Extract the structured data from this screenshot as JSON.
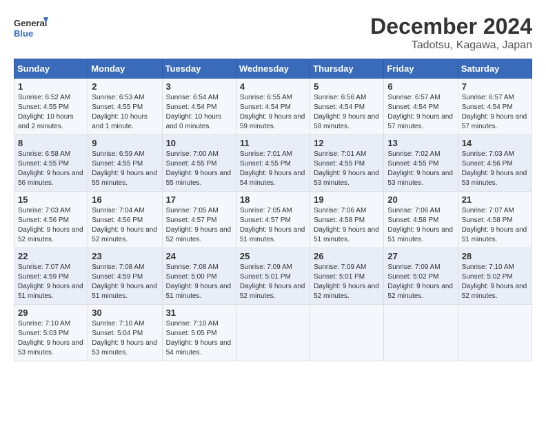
{
  "logo": {
    "line1": "General",
    "line2": "Blue"
  },
  "title": "December 2024",
  "subtitle": "Tadotsu, Kagawa, Japan",
  "weekdays": [
    "Sunday",
    "Monday",
    "Tuesday",
    "Wednesday",
    "Thursday",
    "Friday",
    "Saturday"
  ],
  "weeks": [
    [
      {
        "day": "1",
        "sunrise": "6:52 AM",
        "sunset": "4:55 PM",
        "daylight": "10 hours and 2 minutes."
      },
      {
        "day": "2",
        "sunrise": "6:53 AM",
        "sunset": "4:55 PM",
        "daylight": "10 hours and 1 minute."
      },
      {
        "day": "3",
        "sunrise": "6:54 AM",
        "sunset": "4:54 PM",
        "daylight": "10 hours and 0 minutes."
      },
      {
        "day": "4",
        "sunrise": "6:55 AM",
        "sunset": "4:54 PM",
        "daylight": "9 hours and 59 minutes."
      },
      {
        "day": "5",
        "sunrise": "6:56 AM",
        "sunset": "4:54 PM",
        "daylight": "9 hours and 58 minutes."
      },
      {
        "day": "6",
        "sunrise": "6:57 AM",
        "sunset": "4:54 PM",
        "daylight": "9 hours and 57 minutes."
      },
      {
        "day": "7",
        "sunrise": "6:57 AM",
        "sunset": "4:54 PM",
        "daylight": "9 hours and 57 minutes."
      }
    ],
    [
      {
        "day": "8",
        "sunrise": "6:58 AM",
        "sunset": "4:55 PM",
        "daylight": "9 hours and 56 minutes."
      },
      {
        "day": "9",
        "sunrise": "6:59 AM",
        "sunset": "4:55 PM",
        "daylight": "9 hours and 55 minutes."
      },
      {
        "day": "10",
        "sunrise": "7:00 AM",
        "sunset": "4:55 PM",
        "daylight": "9 hours and 55 minutes."
      },
      {
        "day": "11",
        "sunrise": "7:01 AM",
        "sunset": "4:55 PM",
        "daylight": "9 hours and 54 minutes."
      },
      {
        "day": "12",
        "sunrise": "7:01 AM",
        "sunset": "4:55 PM",
        "daylight": "9 hours and 53 minutes."
      },
      {
        "day": "13",
        "sunrise": "7:02 AM",
        "sunset": "4:55 PM",
        "daylight": "9 hours and 53 minutes."
      },
      {
        "day": "14",
        "sunrise": "7:03 AM",
        "sunset": "4:56 PM",
        "daylight": "9 hours and 53 minutes."
      }
    ],
    [
      {
        "day": "15",
        "sunrise": "7:03 AM",
        "sunset": "4:56 PM",
        "daylight": "9 hours and 52 minutes."
      },
      {
        "day": "16",
        "sunrise": "7:04 AM",
        "sunset": "4:56 PM",
        "daylight": "9 hours and 52 minutes."
      },
      {
        "day": "17",
        "sunrise": "7:05 AM",
        "sunset": "4:57 PM",
        "daylight": "9 hours and 52 minutes."
      },
      {
        "day": "18",
        "sunrise": "7:05 AM",
        "sunset": "4:57 PM",
        "daylight": "9 hours and 51 minutes."
      },
      {
        "day": "19",
        "sunrise": "7:06 AM",
        "sunset": "4:58 PM",
        "daylight": "9 hours and 51 minutes."
      },
      {
        "day": "20",
        "sunrise": "7:06 AM",
        "sunset": "4:58 PM",
        "daylight": "9 hours and 51 minutes."
      },
      {
        "day": "21",
        "sunrise": "7:07 AM",
        "sunset": "4:58 PM",
        "daylight": "9 hours and 51 minutes."
      }
    ],
    [
      {
        "day": "22",
        "sunrise": "7:07 AM",
        "sunset": "4:59 PM",
        "daylight": "9 hours and 51 minutes."
      },
      {
        "day": "23",
        "sunrise": "7:08 AM",
        "sunset": "4:59 PM",
        "daylight": "9 hours and 51 minutes."
      },
      {
        "day": "24",
        "sunrise": "7:08 AM",
        "sunset": "5:00 PM",
        "daylight": "9 hours and 51 minutes."
      },
      {
        "day": "25",
        "sunrise": "7:09 AM",
        "sunset": "5:01 PM",
        "daylight": "9 hours and 52 minutes."
      },
      {
        "day": "26",
        "sunrise": "7:09 AM",
        "sunset": "5:01 PM",
        "daylight": "9 hours and 52 minutes."
      },
      {
        "day": "27",
        "sunrise": "7:09 AM",
        "sunset": "5:02 PM",
        "daylight": "9 hours and 52 minutes."
      },
      {
        "day": "28",
        "sunrise": "7:10 AM",
        "sunset": "5:02 PM",
        "daylight": "9 hours and 52 minutes."
      }
    ],
    [
      {
        "day": "29",
        "sunrise": "7:10 AM",
        "sunset": "5:03 PM",
        "daylight": "9 hours and 53 minutes."
      },
      {
        "day": "30",
        "sunrise": "7:10 AM",
        "sunset": "5:04 PM",
        "daylight": "9 hours and 53 minutes."
      },
      {
        "day": "31",
        "sunrise": "7:10 AM",
        "sunset": "5:05 PM",
        "daylight": "9 hours and 54 minutes."
      },
      null,
      null,
      null,
      null
    ]
  ]
}
